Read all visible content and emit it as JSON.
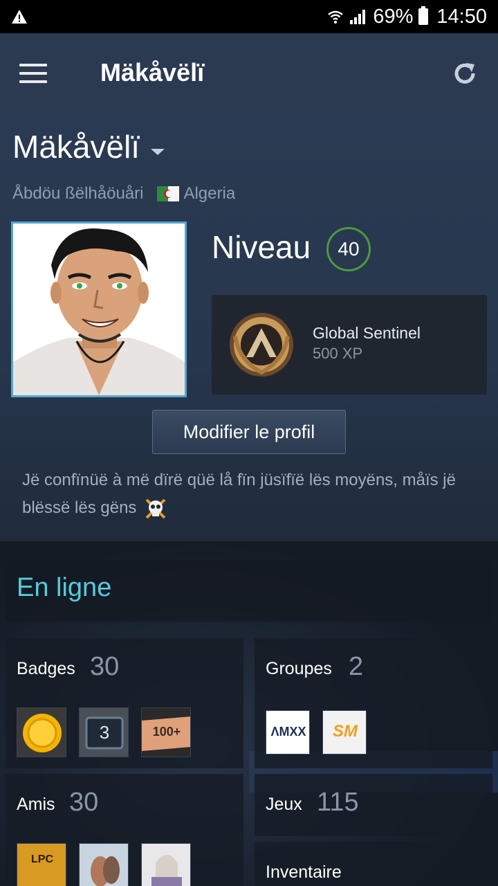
{
  "status_bar": {
    "battery": "69%",
    "time": "14:50"
  },
  "header": {
    "title": "Mäkåvëlï"
  },
  "profile": {
    "persona_name": "Mäkåvëlï",
    "real_name": "Åbdöu ßëlhåöuåri",
    "country": "Algeria",
    "level_label": "Niveau",
    "level": "40",
    "rank_name": "Global Sentinel",
    "rank_xp": "500 XP",
    "edit_button": "Modifier le profil",
    "summary": "Jë confïnüë à më dïrë qüë lå fïn jüsïfïë lës moyëns, måïs jë blëssë lës gëns"
  },
  "online_status": "En ligne",
  "tiles": {
    "badges": {
      "label": "Badges",
      "count": "30",
      "third_badge_text": "100+",
      "second_badge_text": "3"
    },
    "groups": {
      "label": "Groupes",
      "count": "2",
      "group1_text": "ΛMXX",
      "group2_text": "SM"
    },
    "friends": {
      "label": "Amis",
      "count": "30",
      "friend1_text": "LPC"
    },
    "games": {
      "label": "Jeux",
      "count": "115"
    },
    "inventory": {
      "label": "Inventaire"
    }
  },
  "colors": {
    "accent_online": "#57cbde",
    "level_ring": "#4c9a3e",
    "app_bar": "#2b3a51"
  }
}
